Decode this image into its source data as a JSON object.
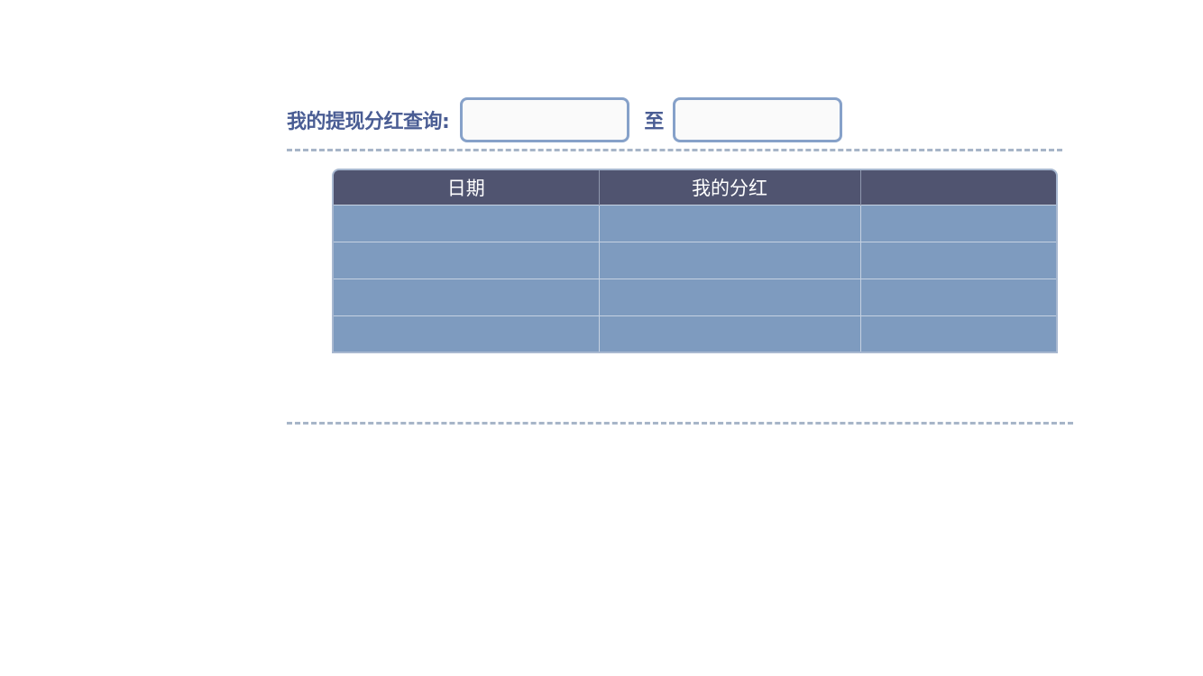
{
  "query": {
    "label": "我的提现分红查询:",
    "start_date": {
      "value": "",
      "placeholder": ""
    },
    "separator": "至",
    "end_date": {
      "value": "",
      "placeholder": ""
    }
  },
  "table": {
    "columns": [
      "日期",
      "我的分红",
      ""
    ],
    "rows": [
      [
        "",
        "",
        ""
      ],
      [
        "",
        "",
        ""
      ],
      [
        "",
        "",
        ""
      ],
      [
        "",
        "",
        ""
      ]
    ]
  },
  "colors": {
    "label": "#4a5d94",
    "input_border": "#86a1c9",
    "header_bg": "#505470",
    "row_bg": "#7e9bbf",
    "dash": "#a7b5c8"
  }
}
